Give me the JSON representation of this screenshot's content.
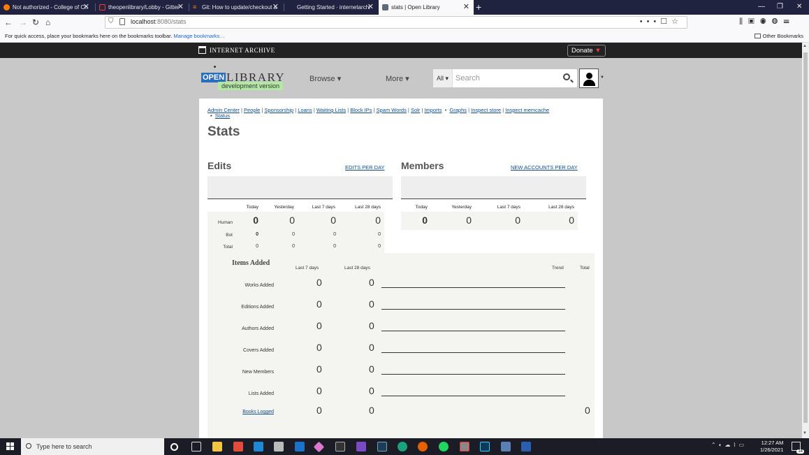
{
  "browser": {
    "tabs": [
      {
        "title": "Not authorized - College of Ch",
        "color": "#ff7a00"
      },
      {
        "title": "theopenlibrary/Lobby - Gitter",
        "color": "#e8345f"
      },
      {
        "title": "Git: How to update/checkout a",
        "color": "#f48024"
      },
      {
        "title": "Getting Started · internetarchi",
        "color": "#666666"
      },
      {
        "title": "stats | Open Library",
        "color": "#5d6b7a"
      }
    ],
    "url_host": "localhost",
    "url_path": ":8080/stats",
    "bookmarks_text": "For quick access, place your bookmarks here on the bookmarks toolbar.",
    "bookmarks_link": "Manage bookmarks…",
    "other_bookmarks": "Other Bookmarks",
    "extension_badge": "2"
  },
  "ia": {
    "logo_text": "INTERNET ARCHIVE",
    "donate_label": "Donate"
  },
  "header": {
    "logo_open": "OPEN",
    "logo_library": "LIBRARY",
    "dev_version": "development version",
    "browse_label": "Browse ▾",
    "more_label": "More ▾",
    "search_scope": "All ▾",
    "search_placeholder": "Search"
  },
  "admin_nav": {
    "links": [
      "Admin Center",
      "People",
      "Sponsorship",
      "Loans",
      "Waiting Lists",
      "Block IPs",
      "Spam Words",
      "Solr",
      "Imports",
      "Graphs",
      "Inspect store",
      "Inspect memcache"
    ],
    "status": "Status"
  },
  "page": {
    "title": "Stats"
  },
  "edits": {
    "heading": "Edits",
    "link": "EDITS PER DAY",
    "columns": [
      "Today",
      "Yesterday",
      "Last 7 days",
      "Last 28 days"
    ],
    "rows": [
      {
        "label": "Human",
        "values": [
          "0",
          "0",
          "0",
          "0"
        ]
      },
      {
        "label": "Bot",
        "values": [
          "0",
          "0",
          "0",
          "0"
        ]
      },
      {
        "label": "Total",
        "values": [
          "0",
          "0",
          "0",
          "0"
        ]
      }
    ]
  },
  "members": {
    "heading": "Members",
    "link": "NEW ACCOUNTS PER DAY",
    "columns": [
      "Today",
      "Yesterday",
      "Last 7 days",
      "Last 28 days"
    ],
    "values": [
      "0",
      "0",
      "0",
      "0"
    ]
  },
  "items_added": {
    "title": "Items Added",
    "columns": [
      "Last 7 days",
      "Last 28 days",
      "Trend",
      "Total"
    ],
    "rows": [
      {
        "label": "Works Added",
        "last7": "0",
        "last28": "0"
      },
      {
        "label": "Editions Added",
        "last7": "0",
        "last28": "0"
      },
      {
        "label": "Authors Added",
        "last7": "0",
        "last28": "0"
      },
      {
        "label": "Covers Added",
        "last7": "0",
        "last28": "0"
      },
      {
        "label": "New Members",
        "last7": "0",
        "last28": "0"
      },
      {
        "label": "Lists Added",
        "last7": "0",
        "last28": "0"
      }
    ],
    "books_logged": {
      "label": "Books Logged",
      "last7": "0",
      "last28": "0",
      "total": "0"
    }
  },
  "taskbar": {
    "search_placeholder": "Type here to search",
    "time": "12:27 AM",
    "date": "1/26/2021",
    "notifications": "14"
  }
}
